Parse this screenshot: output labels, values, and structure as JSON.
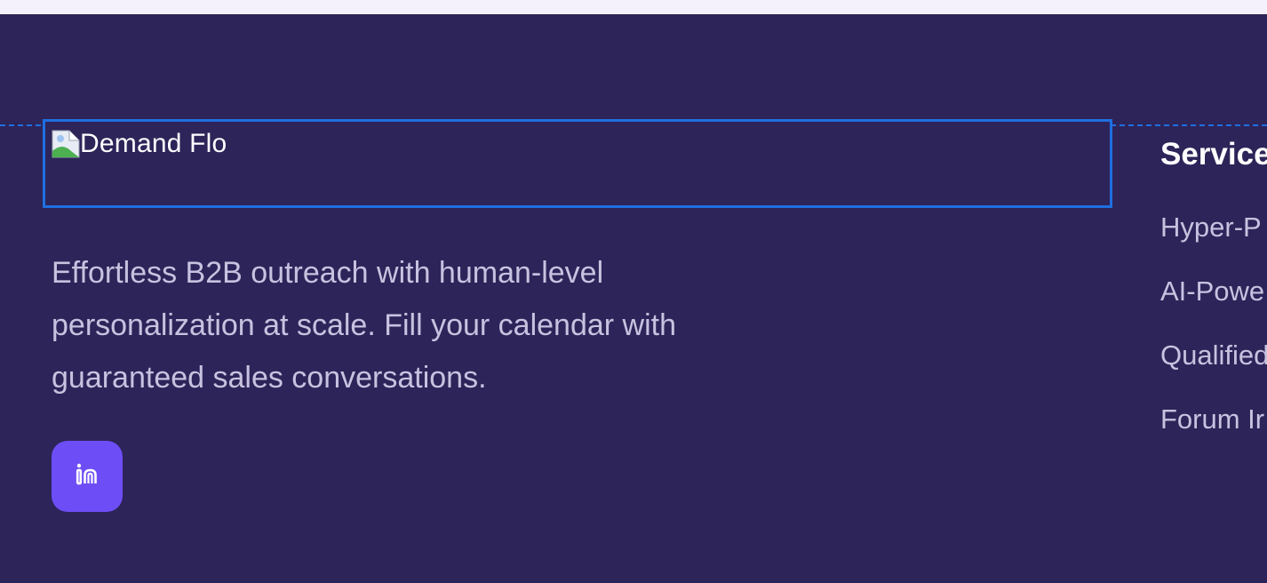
{
  "brand": {
    "logo_alt": "Demand Flo",
    "tagline": "Effortless B2B outreach with human-level personalization at scale. Fill your calendar with guaranteed sales conversations."
  },
  "social": {
    "linkedin_icon": "linkedin-icon"
  },
  "services": {
    "heading": "Service",
    "items": [
      {
        "label": "Hyper-P"
      },
      {
        "label": "AI-Powe"
      },
      {
        "label": "Qualified"
      },
      {
        "label": "Forum Ir"
      }
    ]
  },
  "colors": {
    "background": "#2d2459",
    "accent": "#6d4ef6",
    "selection_outline": "#1f6fe0",
    "text_muted": "#c8c2e0",
    "top_strip": "#f5f1fc"
  }
}
